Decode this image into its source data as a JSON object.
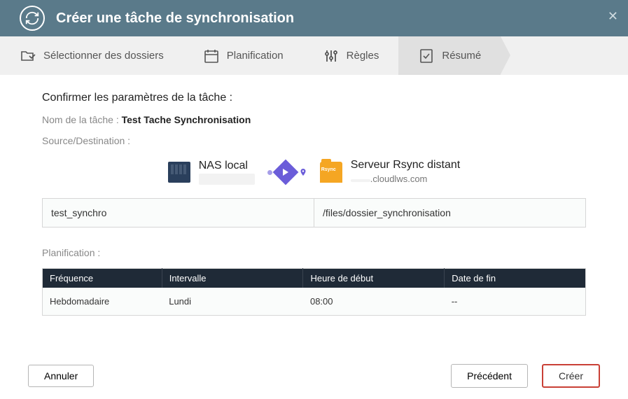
{
  "header": {
    "title": "Créer une tâche de synchronisation"
  },
  "wizard": {
    "step1": "Sélectionner des dossiers",
    "step2": "Planification",
    "step3": "Règles",
    "step4": "Résumé"
  },
  "content": {
    "confirm_title": "Confirmer les paramètres de la tâche :",
    "task_name_label": "Nom de la tâche :",
    "task_name_value": "Test Tache Synchronisation",
    "source_dest_label": "Source/Destination :",
    "source": {
      "title": "NAS local",
      "sub": ""
    },
    "destination": {
      "title": "Serveur Rsync distant",
      "sub": ".cloudlws.com"
    },
    "source_path": "test_synchro",
    "dest_path": "/files/dossier_synchronisation",
    "planif_label": "Planification :",
    "schedule": {
      "headers": {
        "frequency": "Fréquence",
        "interval": "Intervalle",
        "start_time": "Heure de début",
        "end_date": "Date de fin"
      },
      "row": {
        "frequency": "Hebdomadaire",
        "interval": "Lundi",
        "start_time": "08:00",
        "end_date": "--"
      }
    }
  },
  "footer": {
    "cancel": "Annuler",
    "previous": "Précédent",
    "create": "Créer"
  }
}
